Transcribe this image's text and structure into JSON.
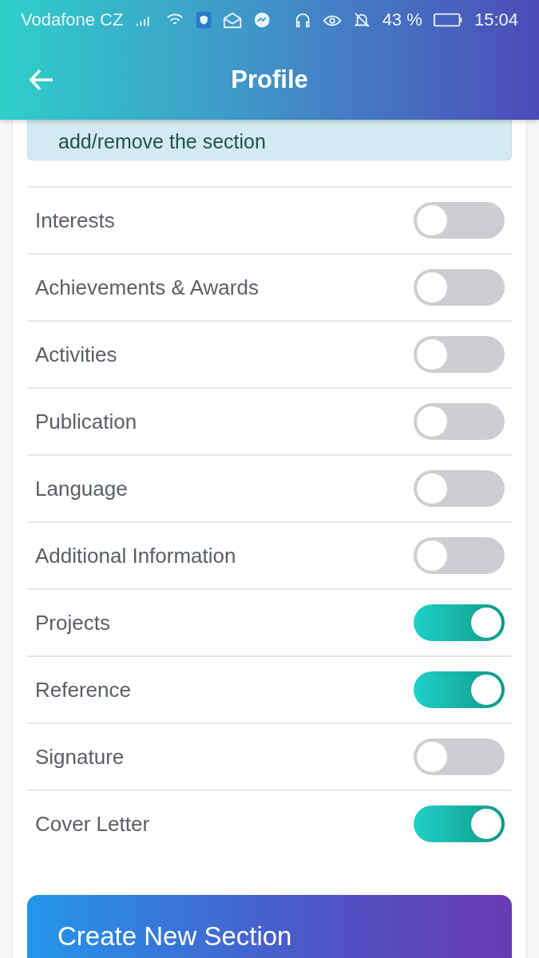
{
  "status_bar": {
    "carrier": "Vodafone CZ",
    "battery": "43 %",
    "time": "15:04"
  },
  "header": {
    "title": "Profile"
  },
  "note": {
    "text": "add/remove the section"
  },
  "sections": [
    {
      "label": "Interests",
      "on": false
    },
    {
      "label": "Achievements & Awards",
      "on": false
    },
    {
      "label": "Activities",
      "on": false
    },
    {
      "label": "Publication",
      "on": false
    },
    {
      "label": "Language",
      "on": false
    },
    {
      "label": "Additional Information",
      "on": false
    },
    {
      "label": "Projects",
      "on": true
    },
    {
      "label": "Reference",
      "on": true
    },
    {
      "label": "Signature",
      "on": false
    },
    {
      "label": "Cover Letter",
      "on": true
    }
  ],
  "create_button": {
    "label": "Create New Section"
  }
}
